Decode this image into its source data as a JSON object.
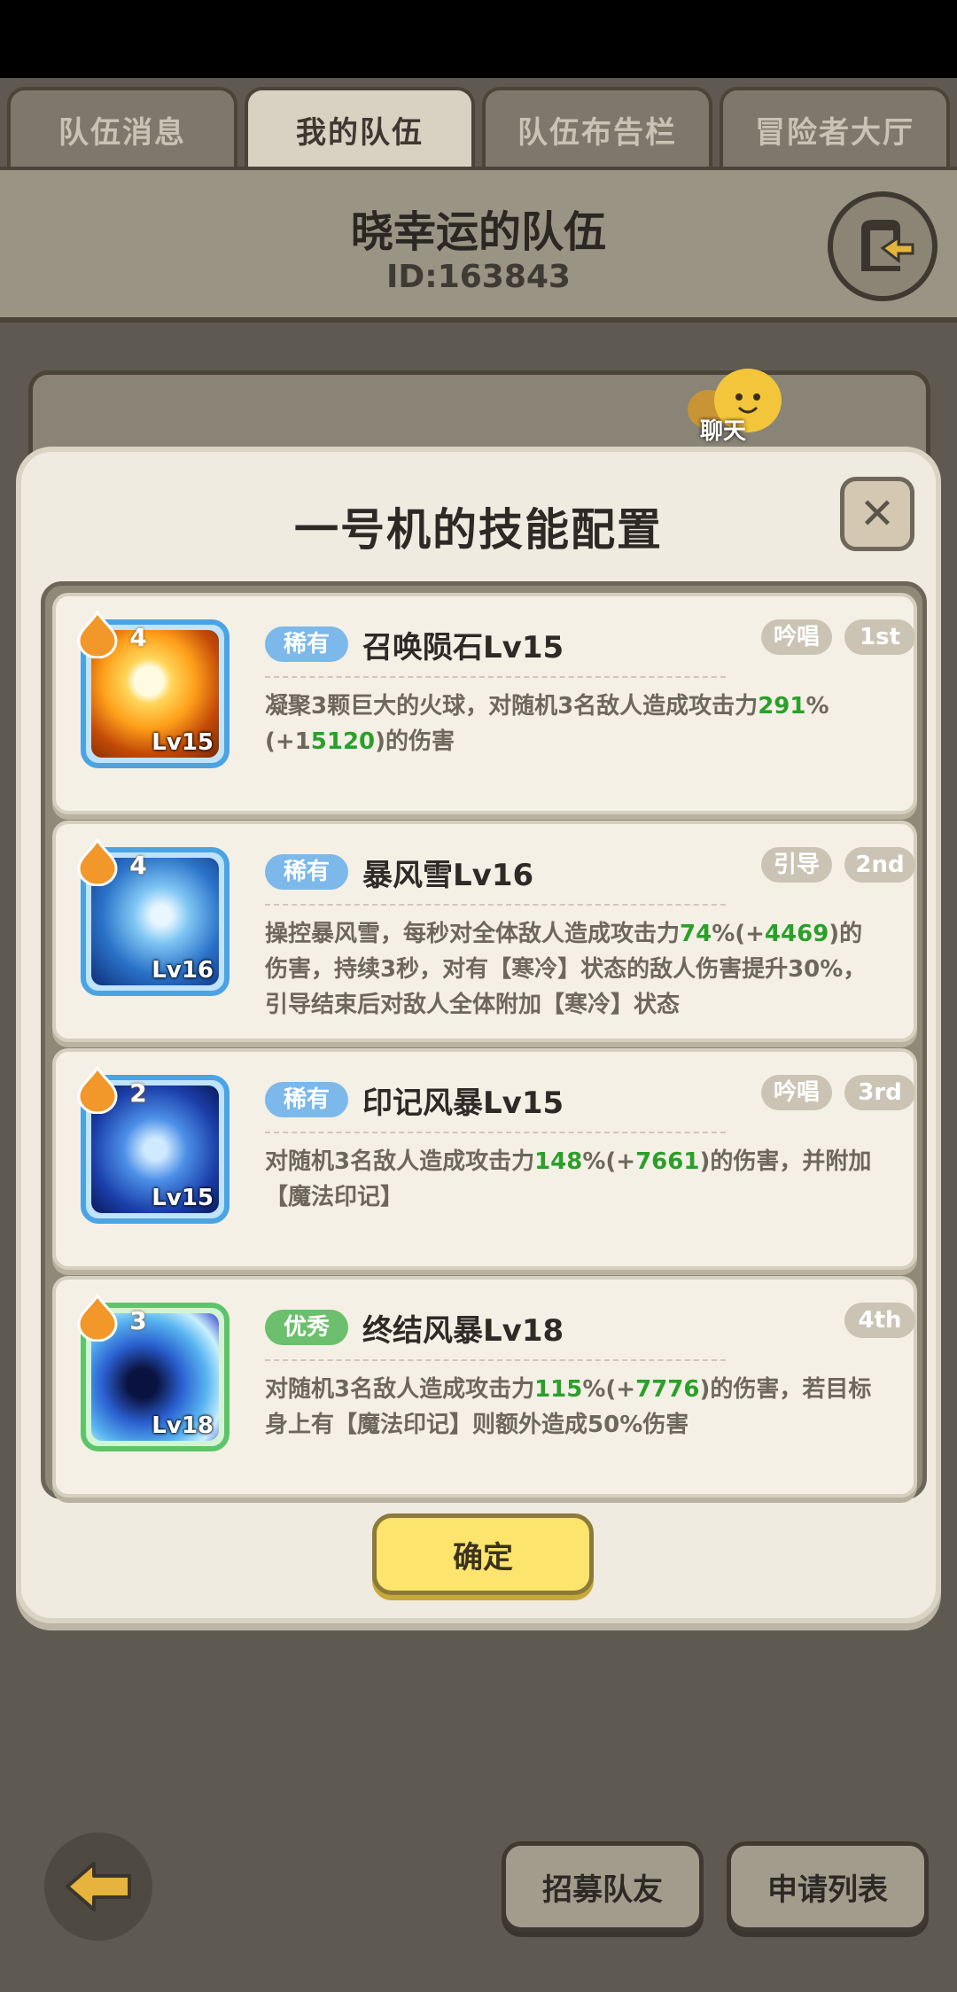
{
  "tabs": [
    {
      "label": "队伍消息"
    },
    {
      "label": "我的队伍"
    },
    {
      "label": "队伍布告栏"
    },
    {
      "label": "冒险者大厅"
    }
  ],
  "team": {
    "name": "晓幸运的队伍",
    "id": "ID:163843"
  },
  "chat": {
    "label": "聊天"
  },
  "modal": {
    "title": "一号机的技能配置",
    "confirm_label": "确定",
    "skills": [
      {
        "badge": "4",
        "icon_level": "Lv15",
        "rarity": "稀有",
        "name": "召唤陨石Lv15",
        "tag": "吟唱",
        "order": "1st",
        "desc_a": "凝聚3颗巨大的火球，对随机3名敌人造成攻击力",
        "hl_a": "291",
        "desc_b": "%(+1",
        "hl_b": "5120",
        "desc_c": ")的伤害",
        "desc_d": ""
      },
      {
        "badge": "4",
        "icon_level": "Lv16",
        "rarity": "稀有",
        "name": "暴风雪Lv16",
        "tag": "引导",
        "order": "2nd",
        "desc_a": "操控暴风雪，每秒对全体敌人造成攻击力",
        "hl_a": "74",
        "desc_b": "%(+",
        "hl_b": "4469",
        "desc_c": ")的",
        "desc_d": "伤害，持续3秒，对有【寒冷】状态的敌人伤害提升30%，引导结束后对敌人全体附加【寒冷】状态"
      },
      {
        "badge": "2",
        "icon_level": "Lv15",
        "rarity": "稀有",
        "name": "印记风暴Lv15",
        "tag": "吟唱",
        "order": "3rd",
        "desc_a": "对随机3名敌人造成攻击力",
        "hl_a": "148",
        "desc_b": "%(+",
        "hl_b": "7661",
        "desc_c": ")的伤害，并附加",
        "desc_d": "【魔法印记】"
      },
      {
        "badge": "3",
        "icon_level": "Lv18",
        "rarity": "优秀",
        "name": "终结风暴Lv18",
        "tag": "",
        "order": "4th",
        "desc_a": "对随机3名敌人造成攻击力",
        "hl_a": "115",
        "desc_b": "%(+",
        "hl_b": "7776",
        "desc_c": ")的伤害，若目标身",
        "desc_d": "上有【魔法印记】则额外造成50%伤害"
      }
    ]
  },
  "bottom": {
    "recruit_label": "招募队友",
    "apply_label": "申请列表"
  },
  "colors": {
    "rare": "#7cb8ea",
    "good": "#6cbf6c",
    "highlight": "#2aa02a",
    "confirm": "#fde46c"
  }
}
